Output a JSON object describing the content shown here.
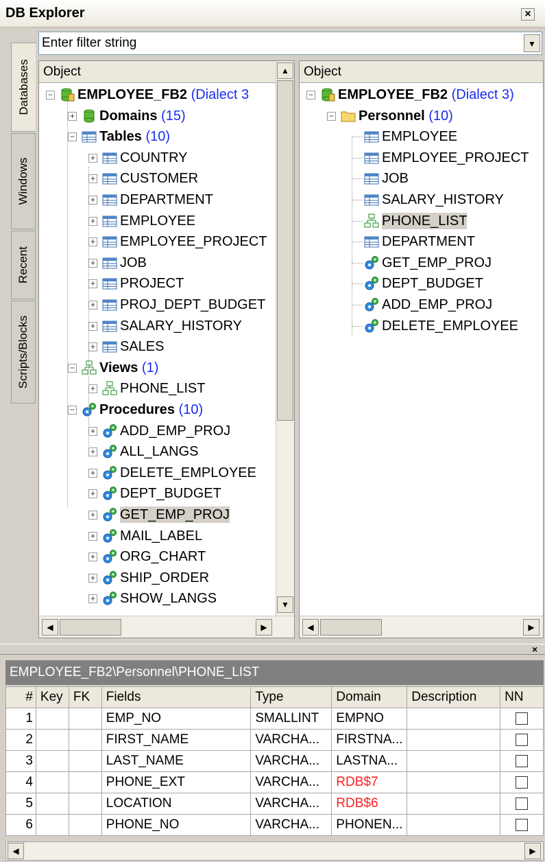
{
  "window": {
    "title": "DB Explorer"
  },
  "filter": {
    "placeholder": "Enter filter string"
  },
  "side_tabs": [
    "Databases",
    "Windows",
    "Recent",
    "Scripts/Blocks"
  ],
  "left_tree": {
    "header": "Object",
    "db": {
      "name": "EMPLOYEE_FB2",
      "dialect": "(Dialect 3"
    },
    "domains": {
      "label": "Domains",
      "count": "(15)"
    },
    "tables": {
      "label": "Tables",
      "count": "(10)",
      "items": [
        "COUNTRY",
        "CUSTOMER",
        "DEPARTMENT",
        "EMPLOYEE",
        "EMPLOYEE_PROJECT",
        "JOB",
        "PROJECT",
        "PROJ_DEPT_BUDGET",
        "SALARY_HISTORY",
        "SALES"
      ]
    },
    "views": {
      "label": "Views",
      "count": "(1)",
      "items": [
        "PHONE_LIST"
      ]
    },
    "procedures": {
      "label": "Procedures",
      "count": "(10)",
      "items": [
        "ADD_EMP_PROJ",
        "ALL_LANGS",
        "DELETE_EMPLOYEE",
        "DEPT_BUDGET",
        "GET_EMP_PROJ",
        "MAIL_LABEL",
        "ORG_CHART",
        "SHIP_ORDER",
        "SHOW_LANGS"
      ]
    },
    "selected": "GET_EMP_PROJ"
  },
  "right_tree": {
    "header": "Object",
    "db": {
      "name": "EMPLOYEE_FB2",
      "dialect": "(Dialect 3)"
    },
    "folder": {
      "label": "Personnel",
      "count": "(10)"
    },
    "items": [
      {
        "label": "EMPLOYEE",
        "icon": "table-icon"
      },
      {
        "label": "EMPLOYEE_PROJECT",
        "icon": "table-icon"
      },
      {
        "label": "JOB",
        "icon": "table-icon"
      },
      {
        "label": "SALARY_HISTORY",
        "icon": "table-icon"
      },
      {
        "label": "PHONE_LIST",
        "icon": "view-icon"
      },
      {
        "label": "DEPARTMENT",
        "icon": "table-icon"
      },
      {
        "label": "GET_EMP_PROJ",
        "icon": "procedure-icon"
      },
      {
        "label": "DEPT_BUDGET",
        "icon": "procedure-icon"
      },
      {
        "label": "ADD_EMP_PROJ",
        "icon": "procedure-icon"
      },
      {
        "label": "DELETE_EMPLOYEE",
        "icon": "procedure-icon"
      }
    ],
    "selected": "PHONE_LIST"
  },
  "details": {
    "path": "EMPLOYEE_FB2\\Personnel\\PHONE_LIST",
    "columns": [
      "#",
      "Key",
      "FK",
      "Fields",
      "Type",
      "Domain",
      "Description",
      "NN"
    ],
    "rows": [
      {
        "n": "1",
        "key": "",
        "fk": "",
        "field": "EMP_NO",
        "type": "SMALLINT",
        "domain": "EMPNO",
        "domain_red": false,
        "desc": ""
      },
      {
        "n": "2",
        "key": "",
        "fk": "",
        "field": "FIRST_NAME",
        "type": "VARCHA...",
        "domain": "FIRSTNA...",
        "domain_red": false,
        "desc": ""
      },
      {
        "n": "3",
        "key": "",
        "fk": "",
        "field": "LAST_NAME",
        "type": "VARCHA...",
        "domain": "LASTNA...",
        "domain_red": false,
        "desc": ""
      },
      {
        "n": "4",
        "key": "",
        "fk": "",
        "field": "PHONE_EXT",
        "type": "VARCHA...",
        "domain": "RDB$7",
        "domain_red": true,
        "desc": ""
      },
      {
        "n": "5",
        "key": "",
        "fk": "",
        "field": "LOCATION",
        "type": "VARCHA...",
        "domain": "RDB$6",
        "domain_red": true,
        "desc": ""
      },
      {
        "n": "6",
        "key": "",
        "fk": "",
        "field": "PHONE_NO",
        "type": "VARCHA...",
        "domain": "PHONEN...",
        "domain_red": false,
        "desc": ""
      }
    ]
  },
  "colors": {
    "count_blue": "#1a2cf0",
    "red_domain": "#ff2020",
    "path_bar": "#808080"
  }
}
